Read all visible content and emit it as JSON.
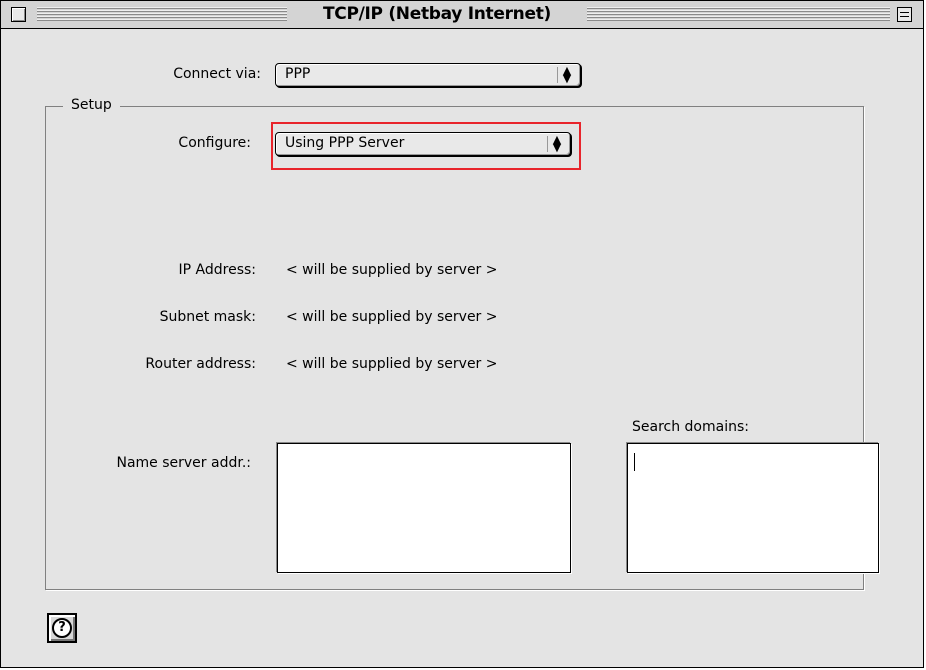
{
  "window": {
    "title": "TCP/IP (Netbay Internet)"
  },
  "connect_via": {
    "label": "Connect via:",
    "value": "PPP"
  },
  "setup": {
    "legend": "Setup",
    "configure": {
      "label": "Configure:",
      "value": "Using PPP Server"
    },
    "ip_address": {
      "label": "IP Address:",
      "value": "< will be supplied by server >"
    },
    "subnet_mask": {
      "label": "Subnet mask:",
      "value": "< will be supplied by server >"
    },
    "router_address": {
      "label": "Router address:",
      "value": "< will be supplied by server >"
    },
    "name_server": {
      "label": "Name server addr.:",
      "value": ""
    },
    "search_domains": {
      "label": "Search domains:",
      "value": ""
    }
  },
  "help": {
    "glyph": "?"
  },
  "colors": {
    "highlight": "#e8242b",
    "window_bg": "#e4e4e4"
  }
}
